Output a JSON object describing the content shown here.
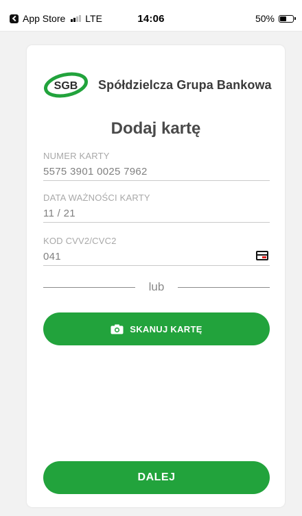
{
  "status_bar": {
    "back_app_label": "App Store",
    "network": "LTE",
    "time": "14:06",
    "battery": "50%"
  },
  "brand": {
    "logo_text": "SGB",
    "bank_name": "Spółdzielcza Grupa Bankowa",
    "accent_color": "#22a33c"
  },
  "page": {
    "title": "Dodaj kartę"
  },
  "form": {
    "card_number": {
      "label": "NUMER KARTY",
      "value": "5575 3901 0025 7962"
    },
    "expiry": {
      "label": "DATA WAŻNOŚCI KARTY",
      "value": "11 / 21"
    },
    "cvv": {
      "label": "KOD CVV2/CVC2",
      "value": "041",
      "icon": "credit-card-icon"
    }
  },
  "divider": {
    "text": "lub"
  },
  "actions": {
    "scan_label": "SKANUJ KARTĘ",
    "scan_icon": "camera-icon",
    "next_label": "DALEJ"
  }
}
